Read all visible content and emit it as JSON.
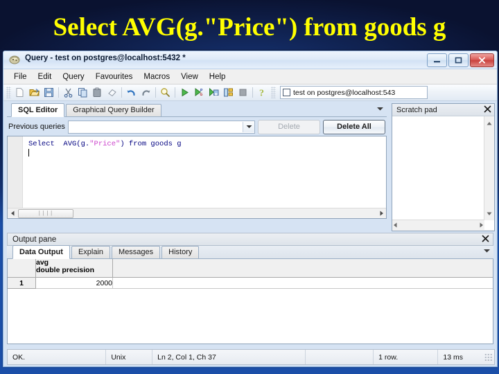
{
  "slide": {
    "title": "Select  AVG(g.\"Price\") from goods g",
    "title_color": "#ffff00",
    "background_color": "#1b4fa8"
  },
  "window": {
    "title": "Query - test on postgres@localhost:5432 *",
    "icon": "postgres-query-icon",
    "buttons": {
      "minimize": "minimize-button",
      "maximize": "maximize-button",
      "close": "close-button"
    }
  },
  "menubar": {
    "items": [
      {
        "label": "File"
      },
      {
        "label": "Edit"
      },
      {
        "label": "Query"
      },
      {
        "label": "Favourites"
      },
      {
        "label": "Macros"
      },
      {
        "label": "View"
      },
      {
        "label": "Help"
      }
    ]
  },
  "toolbar": {
    "buttons": [
      {
        "name": "new-file-icon"
      },
      {
        "name": "open-file-icon"
      },
      {
        "name": "save-file-icon"
      },
      {
        "name": "cut-icon"
      },
      {
        "name": "copy-icon"
      },
      {
        "name": "paste-icon"
      },
      {
        "name": "clear-icon"
      },
      {
        "name": "undo-icon"
      },
      {
        "name": "redo-icon"
      },
      {
        "name": "find-icon"
      },
      {
        "name": "execute-query-icon"
      },
      {
        "name": "explain-query-icon"
      },
      {
        "name": "execute-to-file-icon"
      },
      {
        "name": "query-plan-icon"
      },
      {
        "name": "stop-icon"
      },
      {
        "name": "help-icon"
      }
    ],
    "connection": {
      "value": "test on postgres@localhost:543",
      "checked": false
    }
  },
  "editor_panel": {
    "tabs": [
      {
        "label": "SQL Editor",
        "active": true
      },
      {
        "label": "Graphical Query Builder",
        "active": false
      }
    ],
    "previous_queries": {
      "label": "Previous queries",
      "value": "",
      "placeholder": ""
    },
    "delete_button": {
      "label": "Delete",
      "disabled": true
    },
    "delete_all_button": {
      "label": "Delete All",
      "disabled": false
    },
    "sql": {
      "prefix": "Select  AVG(g.",
      "quoted": "\"Price\"",
      "suffix": ") from goods g"
    }
  },
  "scratch_pad": {
    "title": "Scratch pad",
    "content": "",
    "close": "close-icon"
  },
  "output_pane": {
    "title": "Output pane",
    "close": "close-icon",
    "tabs": [
      {
        "label": "Data Output",
        "active": true
      },
      {
        "label": "Explain",
        "active": false
      },
      {
        "label": "Messages",
        "active": false
      },
      {
        "label": "History",
        "active": false
      }
    ],
    "grid": {
      "columns": [
        {
          "name": "avg",
          "type": "double precision"
        }
      ],
      "rows": [
        {
          "num": "1",
          "values": [
            "2000"
          ]
        }
      ]
    }
  },
  "statusbar": {
    "cells": [
      {
        "text": "OK."
      },
      {
        "text": "Unix"
      },
      {
        "text": "Ln 2, Col 1, Ch 37"
      },
      {
        "text": ""
      },
      {
        "text": "1 row."
      },
      {
        "text": "13 ms"
      }
    ]
  }
}
